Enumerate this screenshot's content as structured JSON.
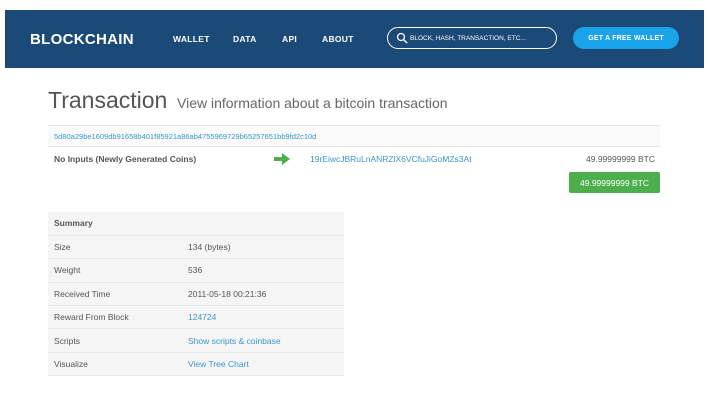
{
  "header": {
    "brand": "BLOCKCHAIN",
    "nav": [
      "WALLET",
      "DATA",
      "API",
      "ABOUT"
    ],
    "search_placeholder": "BLOCK, HASH, TRANSACTION, ETC...",
    "cta_label": "GET A FREE WALLET"
  },
  "page": {
    "title": "Transaction",
    "subtitle": "View information about a bitcoin transaction"
  },
  "transaction": {
    "hash": "5d80a29be1609db91658b401f85921a86ab4755969729b65257651bb9fd2c10d",
    "inputs_label": "No Inputs (Newly Generated Coins)",
    "output_address": "19rEiwcJBRuLnANRZlX6VCfuJiGoMZs3At",
    "output_amount": "49.99999999 BTC",
    "total": "49.99999999 BTC"
  },
  "summary": {
    "heading": "Summary",
    "rows": [
      {
        "label": "Size",
        "value": "134 (bytes)"
      },
      {
        "label": "Weight",
        "value": "536"
      },
      {
        "label": "Received Time",
        "value": "2011-05-18 00:21:36"
      },
      {
        "label": "Reward From Block",
        "value": "124724"
      },
      {
        "label": "Scripts",
        "value": "Show scripts & coinbase"
      },
      {
        "label": "Visualize",
        "value": "View Tree Chart"
      }
    ]
  },
  "colors": {
    "header_bg": "#1c4a78",
    "cta_bg": "#1aa3e8",
    "link": "#3a97c9",
    "badge_green": "#4cae4c"
  },
  "icons": {
    "search": "search-icon",
    "arrow": "arrow-right-icon"
  }
}
